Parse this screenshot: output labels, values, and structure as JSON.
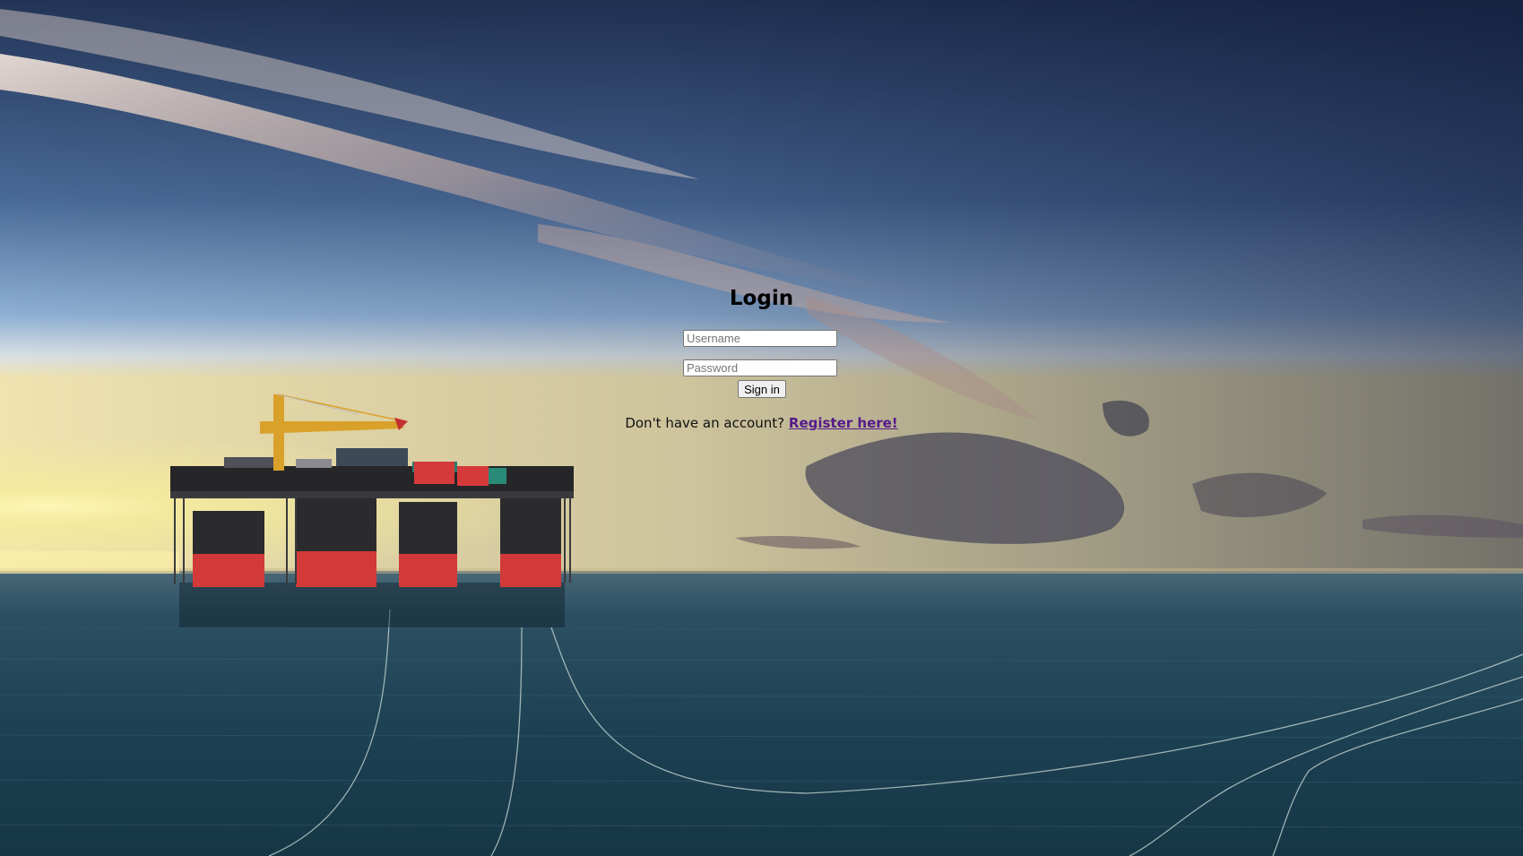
{
  "login": {
    "title": "Login",
    "username_placeholder": "Username",
    "username_value": "",
    "password_placeholder": "Password",
    "password_value": "",
    "signin_label": "Sign in",
    "register_prompt": "Don't have an account?",
    "register_link": "Register here!"
  },
  "background": {
    "scene": "offshore-oil-platform-at-sunset",
    "colors": {
      "sky_top": "#2a3a5e",
      "sky_mid": "#6f8fb8",
      "horizon_glow": "#f3e9a0",
      "sea": "#1d3f52",
      "platform_hull": "#d23a3a",
      "platform_deck": "#2b2b2e",
      "crane": "#d9a12a"
    }
  },
  "theme": {
    "link_color": "#551a8b",
    "text_color": "#000000"
  }
}
